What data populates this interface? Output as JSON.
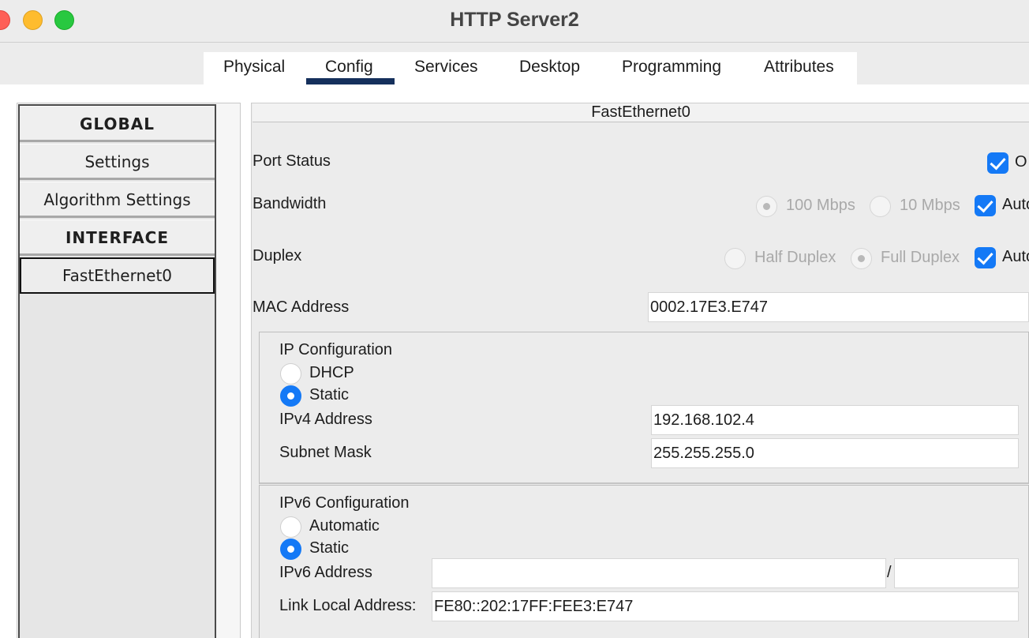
{
  "window": {
    "title": "HTTP Server2"
  },
  "tabs": [
    {
      "label": "Physical"
    },
    {
      "label": "Config"
    },
    {
      "label": "Services"
    },
    {
      "label": "Desktop"
    },
    {
      "label": "Programming"
    },
    {
      "label": "Attributes"
    }
  ],
  "active_tab": "Config",
  "sidebar": {
    "items": [
      {
        "label": "GLOBAL"
      },
      {
        "label": "Settings"
      },
      {
        "label": "Algorithm Settings"
      },
      {
        "label": "INTERFACE"
      },
      {
        "label": "FastEthernet0"
      }
    ],
    "selected": "FastEthernet0"
  },
  "panel": {
    "header": "FastEthernet0",
    "port_status": {
      "label": "Port Status",
      "checkbox_text": "O",
      "checked": true
    },
    "bandwidth": {
      "label": "Bandwidth",
      "option_100": "100 Mbps",
      "option_10": "10 Mbps",
      "auto": "Auto",
      "auto_checked": true
    },
    "duplex": {
      "label": "Duplex",
      "half": "Half Duplex",
      "full": "Full Duplex",
      "auto": "Auto",
      "auto_checked": true
    },
    "mac": {
      "label": "MAC Address",
      "value": "0002.17E3.E747"
    },
    "ip_config": {
      "title": "IP Configuration",
      "dhcp": "DHCP",
      "static": "Static",
      "selected": "Static",
      "ipv4_label": "IPv4 Address",
      "ipv4_value": "192.168.102.4",
      "mask_label": "Subnet Mask",
      "mask_value": "255.255.255.0"
    },
    "ipv6_config": {
      "title": "IPv6 Configuration",
      "automatic": "Automatic",
      "static": "Static",
      "selected": "Static",
      "ipv6_label": "IPv6 Address",
      "ipv6_value": "",
      "prefix_sep": "/",
      "prefix_value": "",
      "link_local_label": "Link Local Address:",
      "link_local_value": "FE80::202:17FF:FEE3:E747"
    }
  },
  "colors": {
    "accent": "#1479f6",
    "tab_underline": "#15305c",
    "close": "#fe5f57",
    "minimize": "#febc2e",
    "maximize": "#28c840"
  }
}
